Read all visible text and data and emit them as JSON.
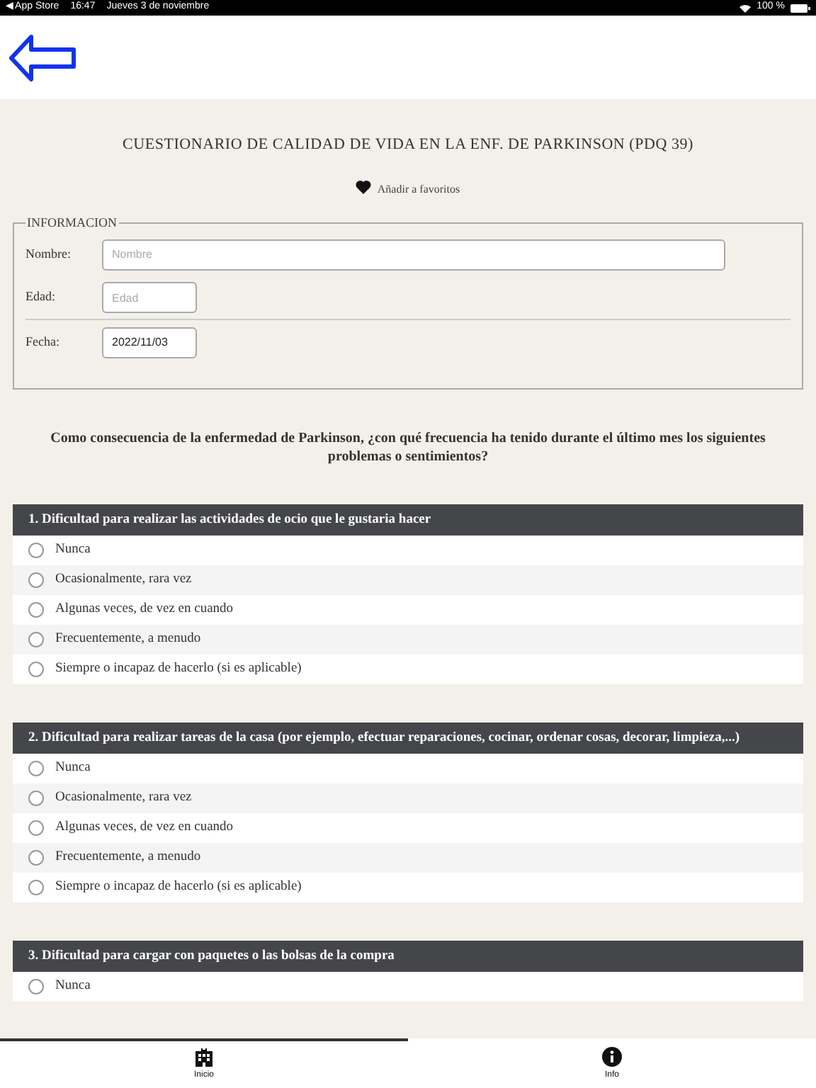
{
  "status_bar": {
    "back_app": "◀ App Store",
    "time": "16:47",
    "date": "Jueves 3 de noviembre",
    "battery": "100 %"
  },
  "title": "CUESTIONARIO DE CALIDAD DE VIDA EN LA ENF. DE PARKINSON (PDQ 39)",
  "favorite": {
    "label": "Añadir a favoritos"
  },
  "info": {
    "legend": "INFORMACION",
    "fields": [
      {
        "label": "Nombre:",
        "placeholder": "Nombre",
        "kind": "wide"
      },
      {
        "label": "Edad:",
        "placeholder": "Edad",
        "kind": "short"
      },
      {
        "label": "Fecha:",
        "value": "2022/11/03",
        "kind": "short"
      }
    ]
  },
  "intro": "Como consecuencia de la enfermedad de Parkinson, ¿con qué frecuencia ha tenido durante el último mes los siguientes problemas o sentimientos?",
  "questions": [
    {
      "title": "1. Dificultad para realizar las actividades de ocio que le gustaria hacer",
      "options": [
        {
          "label": "Nunca",
          "selected": false
        },
        {
          "label": "Ocasionalmente, rara vez",
          "selected": false
        },
        {
          "label": "Algunas veces, de vez en cuando",
          "selected": false
        },
        {
          "label": "Frecuentemente, a menudo",
          "selected": false
        },
        {
          "label": "Siempre o incapaz de hacerlo (si es aplicable)",
          "selected": false
        }
      ]
    },
    {
      "title": "2. Dificultad para realizar tareas de la casa (por ejemplo, efectuar reparaciones, cocinar, ordenar cosas, decorar, limpieza,...)",
      "options": [
        {
          "label": "Nunca",
          "selected": false
        },
        {
          "label": "Ocasionalmente, rara vez",
          "selected": false
        },
        {
          "label": "Algunas veces, de vez en cuando",
          "selected": false
        },
        {
          "label": "Frecuentemente, a menudo",
          "selected": false
        },
        {
          "label": "Siempre o incapaz de hacerlo (si es aplicable)",
          "selected": false
        }
      ]
    },
    {
      "title": "3. Dificultad para cargar con paquetes o las bolsas de la compra",
      "options": [
        {
          "label": "Nunca",
          "selected": false
        }
      ]
    }
  ],
  "tabs": [
    {
      "label": "Inicio",
      "kind": "home",
      "selected": true
    },
    {
      "label": "Info",
      "kind": "info",
      "selected": false
    }
  ]
}
